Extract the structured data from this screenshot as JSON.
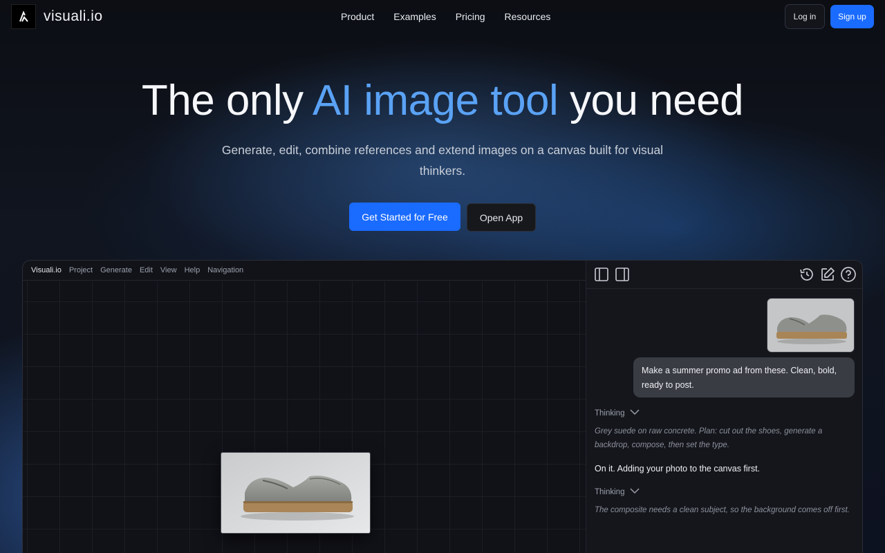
{
  "nav": {
    "brand": "visuali.io",
    "links": [
      "Product",
      "Examples",
      "Pricing",
      "Resources"
    ],
    "login": "Log in",
    "signup": "Sign up"
  },
  "hero": {
    "title_pre": "The only ",
    "title_accent": "AI image tool",
    "title_post": " you need",
    "subtitle": "Generate, edit, combine references and extend images on a canvas built for visual thinkers.",
    "cta_primary": "Get Started for Free",
    "cta_secondary": "Open App"
  },
  "app": {
    "menu": [
      "Visuali.io",
      "Project",
      "Generate",
      "Edit",
      "View",
      "Help",
      "Navigation"
    ],
    "chat": {
      "user_message": "Make a summer promo ad from these. Clean, bold, ready to post.",
      "thinking_label_1": "Thinking",
      "thought_1": "Grey suede on raw concrete. Plan: cut out the shoes, generate a backdrop, compose, then set the type.",
      "reply_1": "On it. Adding your photo to the canvas first.",
      "thinking_label_2": "Thinking",
      "thought_2": "The composite needs a clean subject, so the background comes off first."
    }
  },
  "colors": {
    "accent_blue": "#1a6bff",
    "title_accent": "#5aa2f5",
    "background": "#0b0d12"
  },
  "icons": [
    "logo-icon",
    "panel-left-icon",
    "panel-right-icon",
    "history-icon",
    "edit-icon",
    "help-icon",
    "chevron-down-icon"
  ]
}
